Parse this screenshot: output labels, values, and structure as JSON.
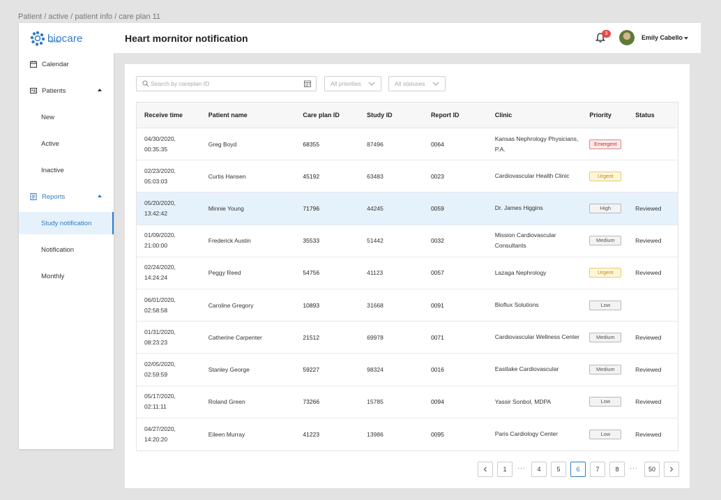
{
  "breadcrumb": "Patient / active / patient info / care plan 11",
  "brand": {
    "name": "biocare",
    "sub": "cardiac",
    "color": "#2e7bc6"
  },
  "sidebar": {
    "calendar": "Calendar",
    "patients": "Patients",
    "patients_sub": [
      "New",
      "Active",
      "Inactive"
    ],
    "reports": "Reports",
    "reports_sub": [
      "Study notification",
      "Notification",
      "Monthly"
    ]
  },
  "header": {
    "title": "Heart mornitor notification",
    "notification_count": "3",
    "user_name": "Emily Cabello"
  },
  "filters": {
    "search_placeholder": "Search by careplan ID",
    "priority": "All priorities",
    "status": "All statuses"
  },
  "table": {
    "columns": [
      "Receive time",
      "Patient name",
      "Care plan ID",
      "Study ID",
      "Report ID",
      "Clinic",
      "Priority",
      "Status"
    ],
    "rows": [
      {
        "date": "04/30/2020,",
        "time": "00:35:35",
        "patient": "Greg Boyd",
        "care_plan": "68355",
        "study": "87496",
        "report": "0064",
        "clinic": "Kansas Nephrology Physicians, P.A.",
        "priority": "Emergent",
        "level": "emergent",
        "status": ""
      },
      {
        "date": "02/23/2020,",
        "time": "05:03:03",
        "patient": "Curtis Hansen",
        "care_plan": "45192",
        "study": "63483",
        "report": "0023",
        "clinic": "Cardiovascular Health Clinic",
        "priority": "Urgent",
        "level": "urgent",
        "status": ""
      },
      {
        "date": "05/20/2020,",
        "time": "13:42:42",
        "patient": "Minnie Young",
        "care_plan": "71796",
        "study": "44245",
        "report": "0059",
        "clinic": "Dr. James Higgins",
        "priority": "High",
        "level": "neutral",
        "status": "Reviewed"
      },
      {
        "date": "01/09/2020,",
        "time": "21:00:00",
        "patient": "Frederick Austin",
        "care_plan": "35533",
        "study": "51442",
        "report": "0032",
        "clinic": "Mission Cardiovascular Consultants",
        "priority": "Medium",
        "level": "neutral",
        "status": "Reviewed"
      },
      {
        "date": "02/24/2020,",
        "time": "14:24:24",
        "patient": "Peggy Reed",
        "care_plan": "54756",
        "study": "41123",
        "report": "0057",
        "clinic": "Lazaga Nephrology",
        "priority": "Urgent",
        "level": "urgent",
        "status": "Reviewed"
      },
      {
        "date": "06/01/2020,",
        "time": "02:58:58",
        "patient": "Caroline Gregory",
        "care_plan": "10893",
        "study": "31668",
        "report": "0091",
        "clinic": "Bioflux Solutions",
        "priority": "Low",
        "level": "neutral",
        "status": ""
      },
      {
        "date": "01/31/2020,",
        "time": "08:23:23",
        "patient": "Catherine Carpenter",
        "care_plan": "21512",
        "study": "69978",
        "report": "0071",
        "clinic": "Cardiovascular Wellness Center",
        "priority": "Medium",
        "level": "neutral",
        "status": "Reviewed"
      },
      {
        "date": "02/05/2020,",
        "time": "02:59:59",
        "patient": "Stanley George",
        "care_plan": "59227",
        "study": "98324",
        "report": "0016",
        "clinic": "Eastlake Cardiovascular",
        "priority": "Medium",
        "level": "neutral",
        "status": "Reviewed"
      },
      {
        "date": "05/17/2020,",
        "time": "02:11:11",
        "patient": "Roland Green",
        "care_plan": "73266",
        "study": "15785",
        "report": "0094",
        "clinic": "Yassir Sonbol, MDPA",
        "priority": "Low",
        "level": "neutral",
        "status": "Reviewed"
      },
      {
        "date": "04/27/2020,",
        "time": "14:20:20",
        "patient": "Eileen Murray",
        "care_plan": "41223",
        "study": "13986",
        "report": "0095",
        "clinic": "Paris Cardiology Center",
        "priority": "Low",
        "level": "neutral",
        "status": "Reviewed"
      }
    ],
    "selected_row": 2
  },
  "pagination": {
    "prev": "<",
    "next": ">",
    "ellipsis": "···",
    "pages": [
      "1",
      "4",
      "5",
      "6",
      "7",
      "8",
      "50"
    ],
    "current": "6"
  }
}
